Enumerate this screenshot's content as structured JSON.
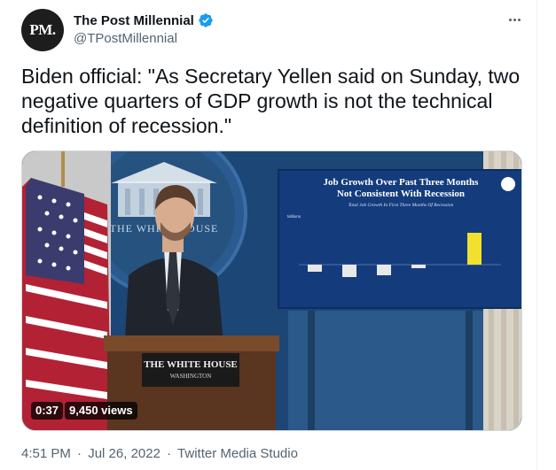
{
  "author": {
    "avatar_text": "PM.",
    "display_name": "The Post Millennial",
    "handle": "@TPostMillennial"
  },
  "tweet": {
    "text": "Biden official: \"As Secretary Yellen said on Sunday, two negative quarters of GDP growth is not the technical definition of recession.\""
  },
  "video": {
    "duration": "0:37",
    "views": "9,450 views",
    "scene": {
      "seal_text": "THE WHITE HOUSE",
      "podium_line1": "THE WHITE HOUSE",
      "podium_line2": "WASHINGTON",
      "slide_title_line1": "Job Growth Over Past Three Months",
      "slide_title_line2": "Not Consistent With Recession",
      "slide_subtitle": "Total Job Growth In First Three Months Of Recession",
      "slide_axis_label": "Millions"
    }
  },
  "meta": {
    "time": "4:51 PM",
    "separator": "·",
    "date": "Jul 26, 2022",
    "source": "Twitter Media Studio"
  },
  "colors": {
    "verified_badge": "#1d9bf0",
    "secondary_text": "#536471",
    "backdrop_blue": "#1f4d80",
    "slide_bar": "#e8e8e8",
    "slide_bar_highlight": "#f2e02e"
  },
  "icons": {
    "verified": "verified-badge-icon",
    "more": "more-dots-icon"
  }
}
